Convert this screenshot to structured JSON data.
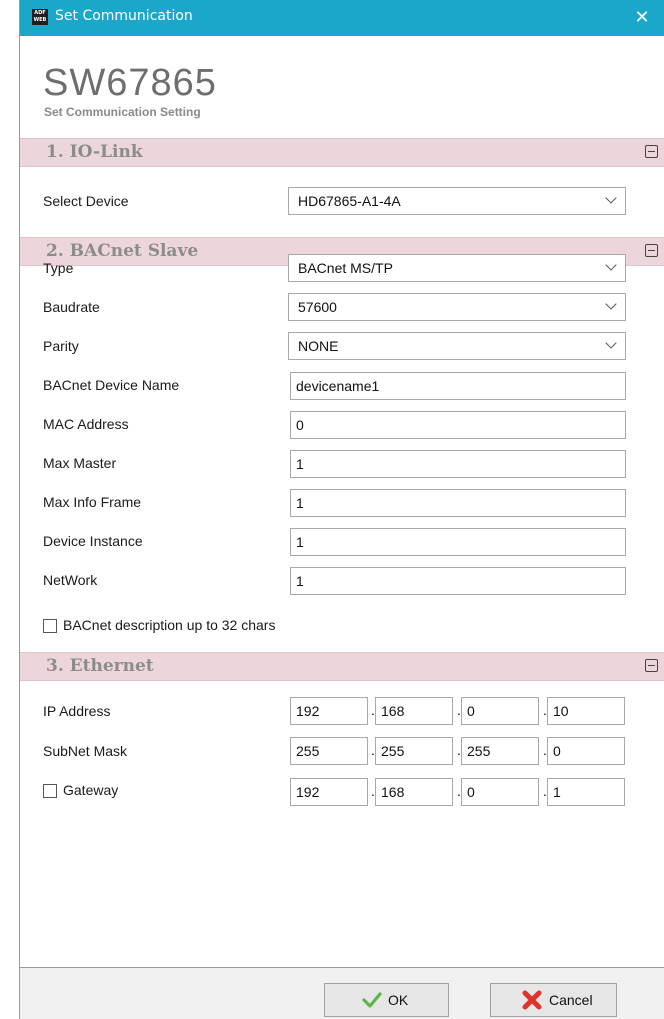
{
  "window": {
    "title": "Set Communication",
    "icon_text": "ADF\nWEB",
    "close_glyph": "✕"
  },
  "header": {
    "app_code": "SW67865",
    "subtitle": "Set Communication Setting"
  },
  "sections": {
    "io_link": {
      "title": "1. IO-Link",
      "select_device_label": "Select Device",
      "select_device_value": "HD67865-A1-4A"
    },
    "bacnet": {
      "title": "2. BACnet Slave",
      "type_label": "Type",
      "type_value": "BACnet MS/TP",
      "baudrate_label": "Baudrate",
      "baudrate_value": "57600",
      "parity_label": "Parity",
      "parity_value": "NONE",
      "device_name_label": "BACnet Device Name",
      "device_name_value": "devicename1",
      "mac_label": "MAC Address",
      "mac_value": "0",
      "max_master_label": "Max Master",
      "max_master_value": "1",
      "max_info_label": "Max Info Frame",
      "max_info_value": "1",
      "instance_label": "Device Instance",
      "instance_value": "1",
      "network_label": "NetWork",
      "network_value": "1",
      "desc_checkbox_label": "BACnet description up to 32 chars",
      "desc_checked": false
    },
    "ethernet": {
      "title": "3. Ethernet",
      "ip_label": "IP Address",
      "ip": [
        "192",
        "168",
        "0",
        "10"
      ],
      "mask_label": "SubNet Mask",
      "mask": [
        "255",
        "255",
        "255",
        "0"
      ],
      "gateway_label": "Gateway",
      "gateway_checked": false,
      "gateway": [
        "192",
        "168",
        "0",
        "1"
      ]
    }
  },
  "footer": {
    "ok_label": "OK",
    "cancel_label": "Cancel"
  },
  "icons": {
    "ok": "checkmark-icon",
    "cancel": "red-x-icon",
    "collapse": "minus-box-icon",
    "dropdown": "chevron-down-icon"
  },
  "colors": {
    "titlebar": "#1aa7c9",
    "section_header": "#ecd6d9",
    "section_title": "#8c8c8c",
    "app_code": "#6e6e6e",
    "ok_green": "#5db54a",
    "cancel_red": "#e0312b"
  }
}
